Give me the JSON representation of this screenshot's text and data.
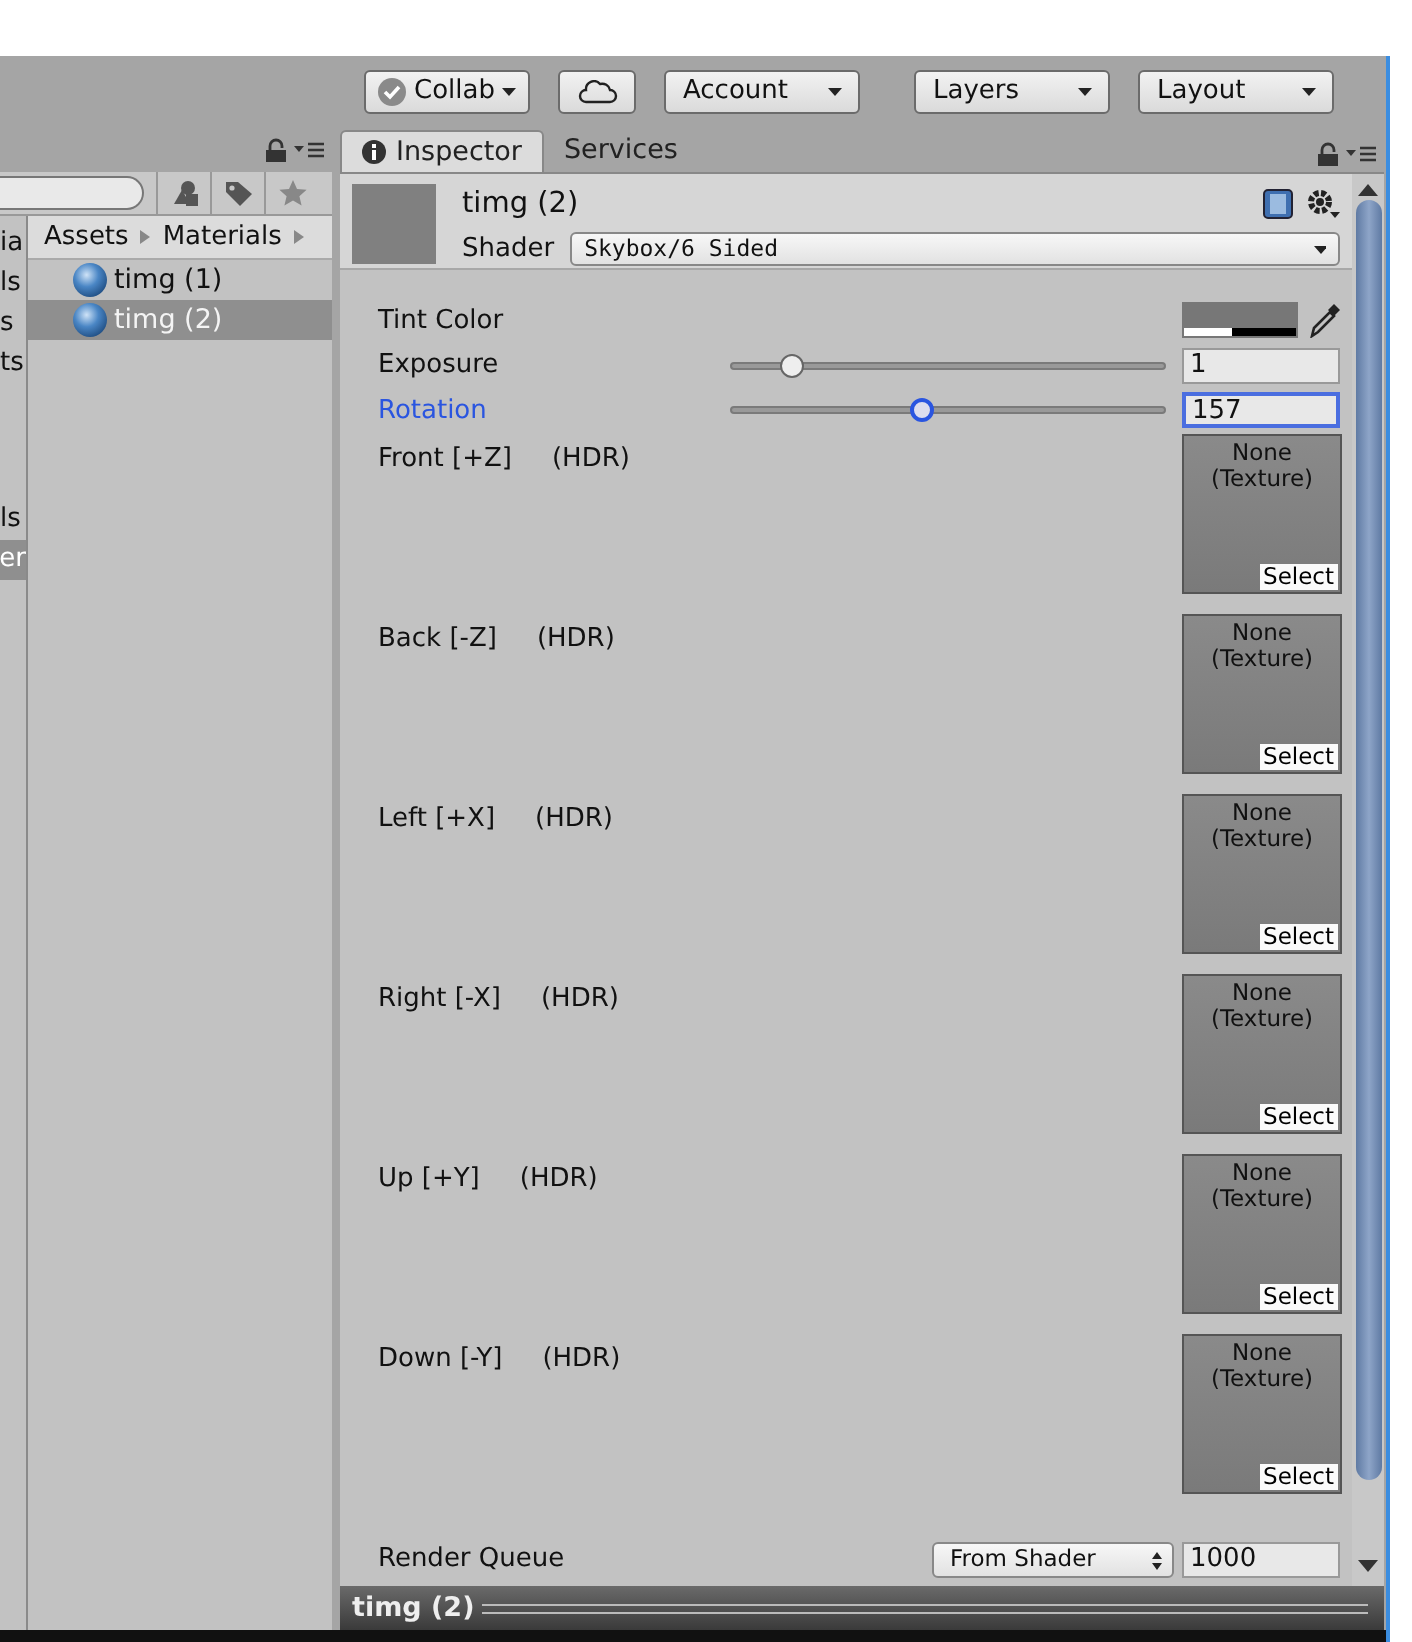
{
  "toolbar": {
    "buttons": [
      {
        "kind": "check-dropdown",
        "label": "Collab"
      },
      {
        "kind": "cloud"
      },
      {
        "kind": "dropdown",
        "label": "Account"
      },
      {
        "kind": "dropdown",
        "label": "Layers"
      },
      {
        "kind": "dropdown",
        "label": "Layout"
      }
    ]
  },
  "project": {
    "folders": [
      {
        "label": "ia",
        "selected": false
      },
      {
        "label": "ls",
        "selected": false
      },
      {
        "label": "s",
        "selected": false
      },
      {
        "label": "ts",
        "selected": false
      },
      {
        "label": "ls",
        "selected": false
      },
      {
        "label": "er",
        "selected": true
      }
    ],
    "breadcrumb": [
      "Assets",
      "Materials"
    ],
    "assets": [
      {
        "label": "timg (1)",
        "selected": false
      },
      {
        "label": "timg (2)",
        "selected": true
      }
    ]
  },
  "inspector": {
    "tabs": [
      {
        "label": "Inspector",
        "selected": true
      },
      {
        "label": "Services",
        "selected": false
      }
    ],
    "name": "timg (2)",
    "shader_label": "Shader",
    "shader": "Skybox/6 Sided",
    "properties": [
      {
        "kind": "color",
        "label": "Tint Color",
        "highlighted": false
      },
      {
        "kind": "slider",
        "label": "Exposure",
        "level": 0.14,
        "value": "1",
        "highlighted": false
      },
      {
        "kind": "slider",
        "label": "Rotation",
        "level": 0.44,
        "value": "157",
        "highlighted": true
      },
      {
        "kind": "texture",
        "label": "Front [+Z]",
        "tag": "(HDR)",
        "slot": "None (Texture)",
        "button": "Select",
        "highlighted": false
      },
      {
        "kind": "texture",
        "label": "Back [-Z]",
        "tag": "(HDR)",
        "slot": "None (Texture)",
        "button": "Select",
        "highlighted": false
      },
      {
        "kind": "texture",
        "label": "Left [+X]",
        "tag": "(HDR)",
        "slot": "None (Texture)",
        "button": "Select",
        "highlighted": false
      },
      {
        "kind": "texture",
        "label": "Right [-X]",
        "tag": "(HDR)",
        "slot": "None (Texture)",
        "button": "Select",
        "highlighted": false
      },
      {
        "kind": "texture",
        "label": "Up [+Y]",
        "tag": "(HDR)",
        "slot": "None (Texture)",
        "button": "Select",
        "highlighted": false
      },
      {
        "kind": "texture",
        "label": "Down [-Y]",
        "tag": "(HDR)",
        "slot": "None (Texture)",
        "button": "Select",
        "highlighted": false
      }
    ],
    "render_queue": {
      "label": "Render Queue",
      "mode": "From Shader",
      "value": "1000"
    }
  },
  "status_bar": {
    "title": "timg (2)"
  }
}
